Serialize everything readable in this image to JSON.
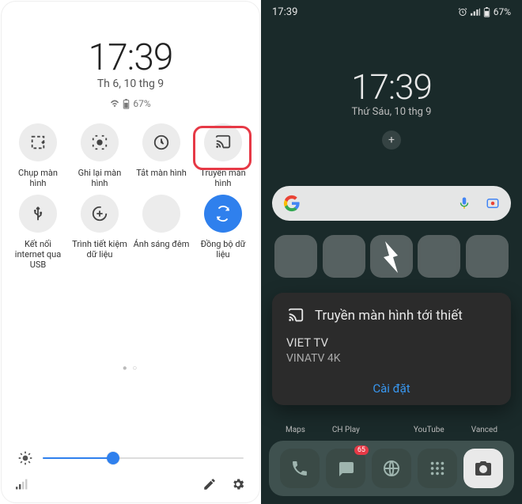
{
  "left": {
    "clock": "17:39",
    "date": "Th 6, 10 thg 9",
    "battery": "67%",
    "tiles": [
      {
        "label": "Chụp màn hình",
        "icon": "screenshot-icon"
      },
      {
        "label": "Ghi lại màn hình",
        "icon": "screenrecord-icon"
      },
      {
        "label": "Tắt màn hình",
        "icon": "screen-off-icon"
      },
      {
        "label": "Truyền màn hình",
        "icon": "cast-icon",
        "highlighted": true
      },
      {
        "label": "Kết nối internet qua USB",
        "icon": "usb-icon"
      },
      {
        "label": "Trình tiết kiệm dữ liệu",
        "icon": "data-saver-icon"
      },
      {
        "label": "Ánh sáng đêm",
        "icon": "night-light-icon"
      },
      {
        "label": "Đồng bộ dữ liệu",
        "icon": "sync-icon",
        "active": true
      }
    ],
    "brightness_pct": 35
  },
  "right": {
    "status_time": "17:39",
    "status_battery": "67%",
    "hs_clock": "17:39",
    "hs_date": "Thứ Sáu, 10 thg 9",
    "cast": {
      "title": "Truyền màn hình tới thiết",
      "device_name": "VIET TV",
      "device_sub": "VINATV 4K",
      "action": "Cài đặt"
    },
    "bottom_labels": [
      "Maps",
      "CH Play",
      "",
      "YouTube",
      "Vanced"
    ],
    "dock_badge": "65"
  }
}
